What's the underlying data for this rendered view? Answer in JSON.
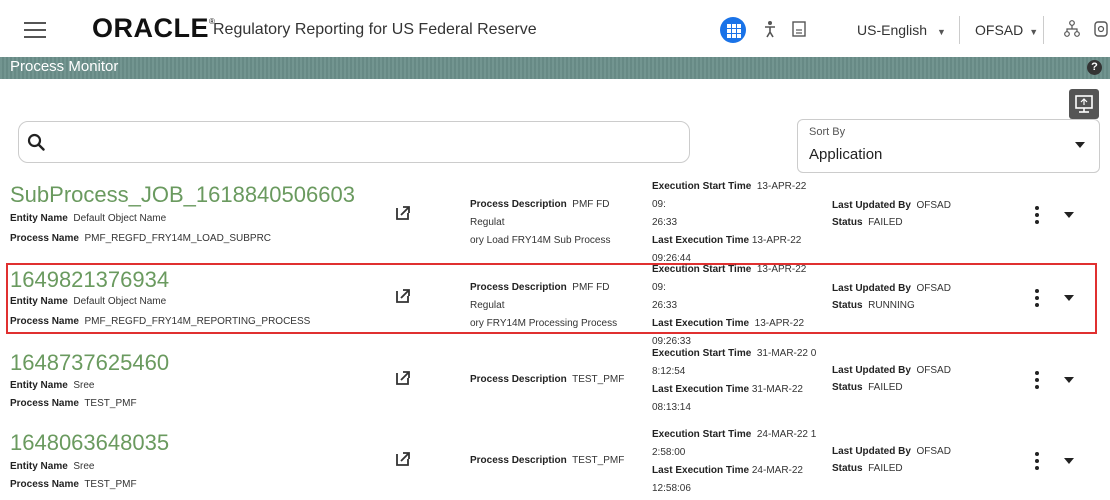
{
  "app": {
    "logo_text": "ORACLE",
    "logo_reg": "®",
    "title": "Regulatory Reporting for US Federal Reserve"
  },
  "header": {
    "language_value": "US-English",
    "user_value": "OFSAD",
    "icons": [
      "menu-icon",
      "apps-grid-icon",
      "accessibility-icon",
      "document-icon",
      "sitemap-icon",
      "settings-icon"
    ]
  },
  "page": {
    "title": "Process Monitor",
    "help_label": "?"
  },
  "search": {
    "placeholder": ""
  },
  "sort": {
    "label": "Sort By",
    "value": "Application"
  },
  "labels": {
    "entity_name": "Entity Name",
    "process_name": "Process Name",
    "process_description": "Process Description",
    "execution_start_time": "Execution Start Time",
    "last_execution_time": "Last Execution Time",
    "last_updated_by": "Last Updated By",
    "status": "Status"
  },
  "processes": [
    {
      "job_id": "SubProcess_JOB_1618840506603",
      "entity_name": "Default Object Name",
      "process_name": "PMF_REGFD_FRY14M_LOAD_SUBPRC",
      "description_l1": "PMF FD Regulat",
      "description_l2": "ory Load FRY14M Sub Process",
      "exec_start_l1": "13-APR-22 09:",
      "exec_start_l2": "26:33",
      "last_exec_l1": "13-APR-22",
      "last_exec_l2": "09:26:44",
      "last_updated_by": "OFSAD",
      "status": "FAILED"
    },
    {
      "job_id": "1649821376934",
      "entity_name": "Default Object Name",
      "process_name": "PMF_REGFD_FRY14M_REPORTING_PROCESS",
      "description_l1": "PMF FD Regulat",
      "description_l2": "ory FRY14M Processing Process",
      "exec_start_l1": "13-APR-22 09:",
      "exec_start_l2": "26:33",
      "last_exec_l1": "13-APR-22",
      "last_exec_l2": "09:26:33",
      "last_updated_by": "OFSAD",
      "status": "RUNNING"
    },
    {
      "job_id": "1648737625460",
      "entity_name": "Sree",
      "process_name": "TEST_PMF",
      "description_l1": "TEST_PMF",
      "description_l2": "",
      "exec_start_l1": "31-MAR-22 0",
      "exec_start_l2": "8:12:54",
      "last_exec_l1": "31-MAR-22",
      "last_exec_l2": "08:13:14",
      "last_updated_by": "OFSAD",
      "status": "FAILED"
    },
    {
      "job_id": "1648063648035",
      "entity_name": "Sree",
      "process_name": "TEST_PMF",
      "description_l1": "TEST_PMF",
      "description_l2": "",
      "exec_start_l1": "24-MAR-22 1",
      "exec_start_l2": "2:58:00",
      "last_exec_l1": "24-MAR-22",
      "last_exec_l2": "12:58:06",
      "last_updated_by": "OFSAD",
      "status": "FAILED"
    }
  ],
  "colors": {
    "job_id": "#6a9a5f",
    "title_bar": "#6b8f8a",
    "highlight": "#e03030",
    "apps_button": "#1a73e8"
  }
}
